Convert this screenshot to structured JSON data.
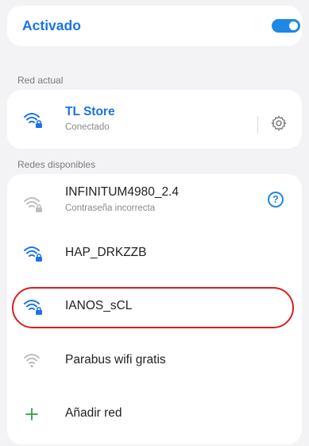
{
  "wifi_toggle": {
    "label": "Activado",
    "enabled": true
  },
  "current_network": {
    "section_label": "Red actual",
    "name": "TL Store",
    "status": "Conectado"
  },
  "available_networks": {
    "section_label": "Redes disponibles",
    "items": [
      {
        "name": "INFINITUM4980_2.4",
        "status": "Contraseña incorrecta",
        "icon": "wifi-lock-icon"
      },
      {
        "name": "HAP_DRKZZB",
        "icon": "wifi-lock-icon"
      },
      {
        "name": "IANOS_sCL",
        "icon": "wifi-lock-icon",
        "highlighted": true
      },
      {
        "name": "Parabus wifi gratis",
        "icon": "wifi-icon"
      }
    ],
    "add_label": "Añadir red"
  },
  "colors": {
    "accent": "#1a73e8",
    "highlight": "#d81e1e",
    "icon_gray": "#bdbdbd"
  }
}
